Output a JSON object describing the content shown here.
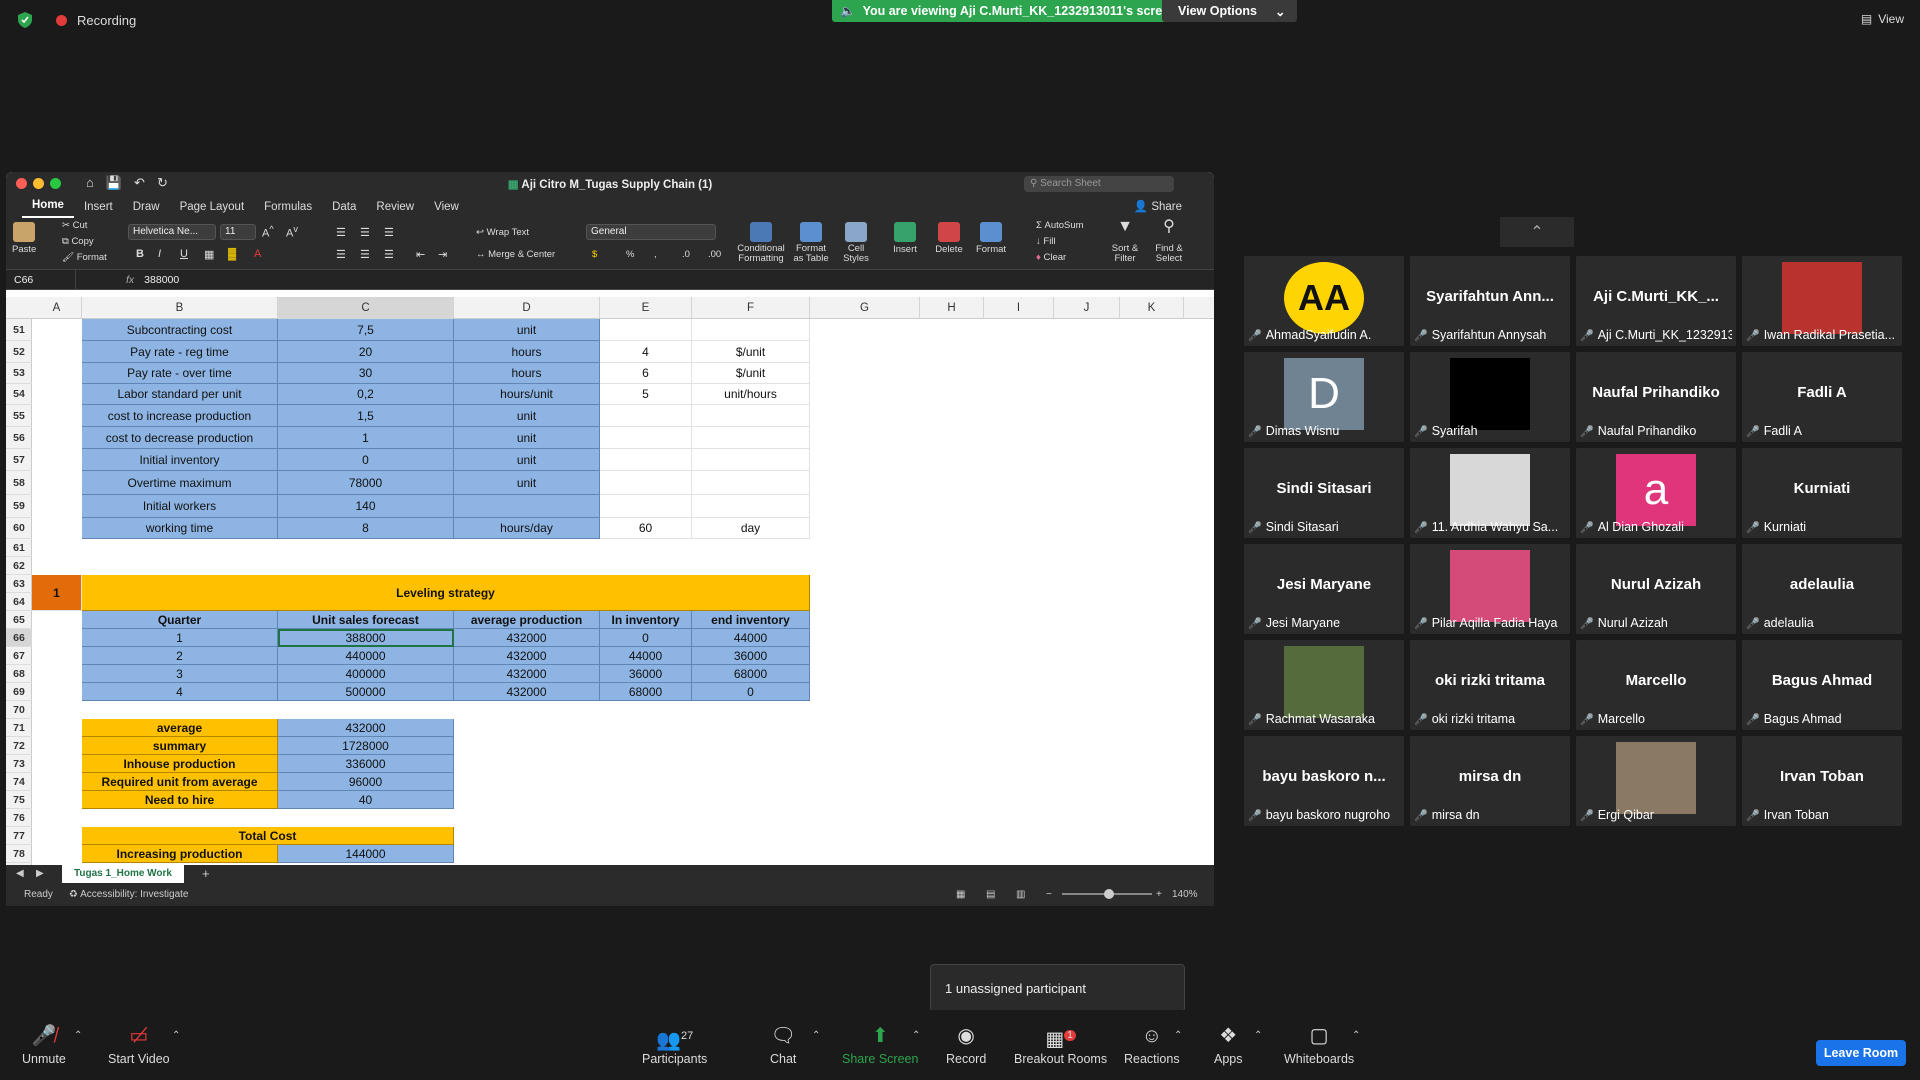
{
  "top": {
    "recording": "Recording",
    "viewing": "You are viewing Aji C.Murti_KK_1232913011's screen",
    "view_options": "View Options",
    "view": "View"
  },
  "excel": {
    "title": "Aji Citro M_Tugas Supply Chain (1)",
    "search_placeholder": "Search Sheet",
    "share": "Share",
    "tabs": [
      "Home",
      "Insert",
      "Draw",
      "Page Layout",
      "Formulas",
      "Data",
      "Review",
      "View"
    ],
    "ribbon": {
      "paste": "Paste",
      "cut": "Cut",
      "copy": "Copy",
      "format": "Format",
      "font": "Helvetica Ne...",
      "size": "11",
      "wrap": "Wrap Text",
      "merge": "Merge & Center",
      "number_format": "General",
      "conditional": "Conditional\nFormatting",
      "format_table": "Format\nas Table",
      "cell_styles": "Cell\nStyles",
      "insert": "Insert",
      "delete": "Delete",
      "format_cells": "Format",
      "autosum": "AutoSum",
      "fill": "Fill",
      "clear": "Clear",
      "sort": "Sort &\nFilter",
      "find": "Find &\nSelect"
    },
    "name_box": "C66",
    "formula": "388000",
    "columns": [
      "A",
      "B",
      "C",
      "D",
      "E",
      "F",
      "G",
      "H",
      "I",
      "J",
      "K",
      "L"
    ],
    "rows": [
      "51",
      "52",
      "53",
      "54",
      "55",
      "56",
      "57",
      "58",
      "59",
      "60",
      "61",
      "62",
      "63",
      "64",
      "65",
      "66",
      "67",
      "68",
      "69",
      "70",
      "71",
      "72",
      "73",
      "74",
      "75",
      "76",
      "77",
      "78"
    ],
    "params": [
      {
        "label": "Subcontracting cost",
        "value": "7,5",
        "unit": "unit",
        "e": "",
        "f": ""
      },
      {
        "label": "Pay rate - reg time",
        "value": "20",
        "unit": "hours",
        "e": "4",
        "f": "$/unit"
      },
      {
        "label": "Pay rate - over time",
        "value": "30",
        "unit": "hours",
        "e": "6",
        "f": "$/unit"
      },
      {
        "label": "Labor standard per unit",
        "value": "0,2",
        "unit": "hours/unit",
        "e": "5",
        "f": "unit/hours"
      },
      {
        "label": "cost to increase production",
        "value": "1,5",
        "unit": "unit",
        "e": "",
        "f": ""
      },
      {
        "label": "cost to decrease production",
        "value": "1",
        "unit": "unit",
        "e": "",
        "f": ""
      },
      {
        "label": "Initial inventory",
        "value": "0",
        "unit": "unit",
        "e": "",
        "f": ""
      },
      {
        "label": "Overtime maximum",
        "value": "78000",
        "unit": "unit",
        "e": "",
        "f": ""
      },
      {
        "label": "Initial workers",
        "value": "140",
        "unit": "",
        "e": "",
        "f": ""
      },
      {
        "label": "working time",
        "value": "8",
        "unit": "hours/day",
        "e": "60",
        "f": "day"
      }
    ],
    "strategy_number": "1",
    "strategy_title": "Leveling strategy",
    "table_headers": [
      "Quarter",
      "Unit sales forecast",
      "average production",
      "In inventory",
      "end inventory"
    ],
    "table_rows": [
      [
        "1",
        "388000",
        "432000",
        "0",
        "44000"
      ],
      [
        "2",
        "440000",
        "432000",
        "44000",
        "36000"
      ],
      [
        "3",
        "400000",
        "432000",
        "36000",
        "68000"
      ],
      [
        "4",
        "500000",
        "432000",
        "68000",
        "0"
      ]
    ],
    "summary": [
      {
        "label": "average",
        "value": "432000"
      },
      {
        "label": "summary",
        "value": "1728000"
      },
      {
        "label": "Inhouse production",
        "value": "336000"
      },
      {
        "label": "Required unit from average",
        "value": "96000"
      },
      {
        "label": "Need to hire",
        "value": "40"
      }
    ],
    "total_cost_title": "Total Cost",
    "increasing_label": "Increasing production",
    "increasing_value": "144000",
    "sheet_tab": "Tugas 1_Home Work",
    "status_ready": "Ready",
    "status_access": "Accessibility: Investigate",
    "zoom": "140%"
  },
  "participants": [
    {
      "name": "",
      "label": "AhmadSyaifudin A.",
      "avatar": "AA",
      "avatar_color": "#ffd400"
    },
    {
      "name": "Syarifahtun Ann...",
      "label": "Syarifahtun Annysah"
    },
    {
      "name": "Aji C.Murti_KK_...",
      "label": "Aji C.Murti_KK_12329130..."
    },
    {
      "name": "",
      "label": "Iwan Radikal Prasetia...",
      "avatar": "",
      "avatar_color": "#b8322e"
    },
    {
      "name": "",
      "label": "Dimas Wisnu",
      "avatar": "D",
      "avatar_color": "#6f8393"
    },
    {
      "name": "",
      "label": "Syarifah",
      "avatar": "",
      "avatar_color": "#000000"
    },
    {
      "name": "Naufal Prihandiko",
      "label": "Naufal Prihandiko"
    },
    {
      "name": "Fadli A",
      "label": "Fadli A"
    },
    {
      "name": "Sindi Sitasari",
      "label": "Sindi Sitasari"
    },
    {
      "name": "",
      "label": "11. Ardhia Wahyu Sa...",
      "avatar": "",
      "avatar_color": "#d8d8d8"
    },
    {
      "name": "",
      "label": "Al Dian Ghozali",
      "avatar": "a",
      "avatar_color": "#e0357a"
    },
    {
      "name": "Kurniati",
      "label": "Kurniati"
    },
    {
      "name": "Jesi Maryane",
      "label": "Jesi Maryane"
    },
    {
      "name": "",
      "label": "Pilar Aqilla Fadia Haya",
      "avatar": "",
      "avatar_color": "#d44a78"
    },
    {
      "name": "Nurul Azizah",
      "label": "Nurul Azizah"
    },
    {
      "name": "adelaulia",
      "label": "adelaulia"
    },
    {
      "name": "",
      "label": "Rachmat Wasaraka",
      "avatar": "",
      "avatar_color": "#556b3c"
    },
    {
      "name": "oki rizki tritama",
      "label": "oki rizki tritama"
    },
    {
      "name": "Marcello",
      "label": "Marcello"
    },
    {
      "name": "Bagus Ahmad",
      "label": "Bagus Ahmad"
    },
    {
      "name": "bayu baskoro n...",
      "label": "bayu baskoro nugroho"
    },
    {
      "name": "mirsa dn",
      "label": "mirsa dn"
    },
    {
      "name": "",
      "label": "Ergi Qibar",
      "avatar": "",
      "avatar_color": "#8a7a63"
    },
    {
      "name": "Irvan Toban",
      "label": "Irvan Toban"
    }
  ],
  "tooltip": "1 unassigned participant",
  "toolbar": {
    "unmute": "Unmute",
    "start_video": "Start Video",
    "participants": "Participants",
    "participants_count": "27",
    "chat": "Chat",
    "share_screen": "Share Screen",
    "record": "Record",
    "breakout": "Breakout Rooms",
    "breakout_badge": "1",
    "reactions": "Reactions",
    "apps": "Apps",
    "whiteboards": "Whiteboards",
    "leave": "Leave Room"
  }
}
